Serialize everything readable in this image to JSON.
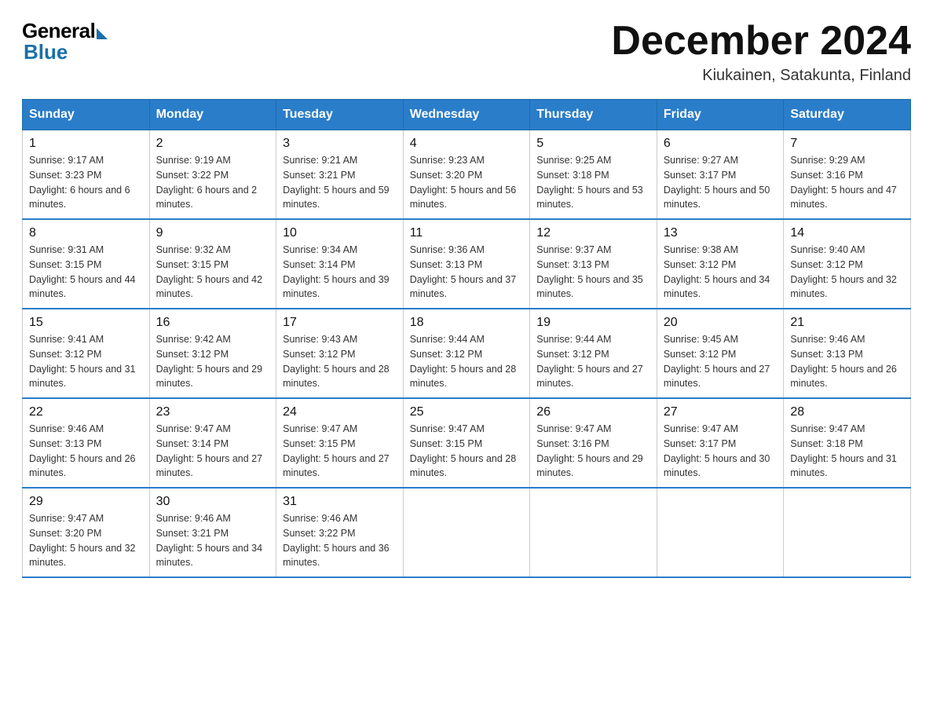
{
  "logo": {
    "general": "General",
    "blue": "Blue"
  },
  "header": {
    "month": "December 2024",
    "location": "Kiukainen, Satakunta, Finland"
  },
  "days_of_week": [
    "Sunday",
    "Monday",
    "Tuesday",
    "Wednesday",
    "Thursday",
    "Friday",
    "Saturday"
  ],
  "weeks": [
    [
      {
        "day": "1",
        "sunrise": "9:17 AM",
        "sunset": "3:23 PM",
        "daylight": "6 hours and 6 minutes."
      },
      {
        "day": "2",
        "sunrise": "9:19 AM",
        "sunset": "3:22 PM",
        "daylight": "6 hours and 2 minutes."
      },
      {
        "day": "3",
        "sunrise": "9:21 AM",
        "sunset": "3:21 PM",
        "daylight": "5 hours and 59 minutes."
      },
      {
        "day": "4",
        "sunrise": "9:23 AM",
        "sunset": "3:20 PM",
        "daylight": "5 hours and 56 minutes."
      },
      {
        "day": "5",
        "sunrise": "9:25 AM",
        "sunset": "3:18 PM",
        "daylight": "5 hours and 53 minutes."
      },
      {
        "day": "6",
        "sunrise": "9:27 AM",
        "sunset": "3:17 PM",
        "daylight": "5 hours and 50 minutes."
      },
      {
        "day": "7",
        "sunrise": "9:29 AM",
        "sunset": "3:16 PM",
        "daylight": "5 hours and 47 minutes."
      }
    ],
    [
      {
        "day": "8",
        "sunrise": "9:31 AM",
        "sunset": "3:15 PM",
        "daylight": "5 hours and 44 minutes."
      },
      {
        "day": "9",
        "sunrise": "9:32 AM",
        "sunset": "3:15 PM",
        "daylight": "5 hours and 42 minutes."
      },
      {
        "day": "10",
        "sunrise": "9:34 AM",
        "sunset": "3:14 PM",
        "daylight": "5 hours and 39 minutes."
      },
      {
        "day": "11",
        "sunrise": "9:36 AM",
        "sunset": "3:13 PM",
        "daylight": "5 hours and 37 minutes."
      },
      {
        "day": "12",
        "sunrise": "9:37 AM",
        "sunset": "3:13 PM",
        "daylight": "5 hours and 35 minutes."
      },
      {
        "day": "13",
        "sunrise": "9:38 AM",
        "sunset": "3:12 PM",
        "daylight": "5 hours and 34 minutes."
      },
      {
        "day": "14",
        "sunrise": "9:40 AM",
        "sunset": "3:12 PM",
        "daylight": "5 hours and 32 minutes."
      }
    ],
    [
      {
        "day": "15",
        "sunrise": "9:41 AM",
        "sunset": "3:12 PM",
        "daylight": "5 hours and 31 minutes."
      },
      {
        "day": "16",
        "sunrise": "9:42 AM",
        "sunset": "3:12 PM",
        "daylight": "5 hours and 29 minutes."
      },
      {
        "day": "17",
        "sunrise": "9:43 AM",
        "sunset": "3:12 PM",
        "daylight": "5 hours and 28 minutes."
      },
      {
        "day": "18",
        "sunrise": "9:44 AM",
        "sunset": "3:12 PM",
        "daylight": "5 hours and 28 minutes."
      },
      {
        "day": "19",
        "sunrise": "9:44 AM",
        "sunset": "3:12 PM",
        "daylight": "5 hours and 27 minutes."
      },
      {
        "day": "20",
        "sunrise": "9:45 AM",
        "sunset": "3:12 PM",
        "daylight": "5 hours and 27 minutes."
      },
      {
        "day": "21",
        "sunrise": "9:46 AM",
        "sunset": "3:13 PM",
        "daylight": "5 hours and 26 minutes."
      }
    ],
    [
      {
        "day": "22",
        "sunrise": "9:46 AM",
        "sunset": "3:13 PM",
        "daylight": "5 hours and 26 minutes."
      },
      {
        "day": "23",
        "sunrise": "9:47 AM",
        "sunset": "3:14 PM",
        "daylight": "5 hours and 27 minutes."
      },
      {
        "day": "24",
        "sunrise": "9:47 AM",
        "sunset": "3:15 PM",
        "daylight": "5 hours and 27 minutes."
      },
      {
        "day": "25",
        "sunrise": "9:47 AM",
        "sunset": "3:15 PM",
        "daylight": "5 hours and 28 minutes."
      },
      {
        "day": "26",
        "sunrise": "9:47 AM",
        "sunset": "3:16 PM",
        "daylight": "5 hours and 29 minutes."
      },
      {
        "day": "27",
        "sunrise": "9:47 AM",
        "sunset": "3:17 PM",
        "daylight": "5 hours and 30 minutes."
      },
      {
        "day": "28",
        "sunrise": "9:47 AM",
        "sunset": "3:18 PM",
        "daylight": "5 hours and 31 minutes."
      }
    ],
    [
      {
        "day": "29",
        "sunrise": "9:47 AM",
        "sunset": "3:20 PM",
        "daylight": "5 hours and 32 minutes."
      },
      {
        "day": "30",
        "sunrise": "9:46 AM",
        "sunset": "3:21 PM",
        "daylight": "5 hours and 34 minutes."
      },
      {
        "day": "31",
        "sunrise": "9:46 AM",
        "sunset": "3:22 PM",
        "daylight": "5 hours and 36 minutes."
      },
      null,
      null,
      null,
      null
    ]
  ]
}
